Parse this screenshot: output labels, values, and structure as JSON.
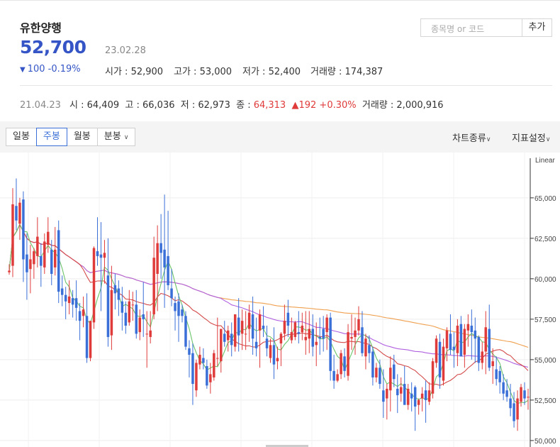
{
  "stock": {
    "name": "유한양행",
    "price": "52,700",
    "date": "23.02.28",
    "change": "100 -0.19%",
    "open": "시가 : 52,900",
    "high": "고가 : 53,000",
    "low": "저가 : 52,400",
    "volume": "거래량 : 174,387"
  },
  "search": {
    "placeholder": "종목명 or 코드",
    "add_label": "추가"
  },
  "history": {
    "date": "21.04.23",
    "open": "시 : 64,409",
    "high": "고 : 66,036",
    "low": "저 : 62,973",
    "close_label": "종 : ",
    "close_value": "64,313",
    "change": "▲192 +0.30%",
    "volume": "거래량 : 2,000,916"
  },
  "toolbar": {
    "tabs": [
      "일봉",
      "주봉",
      "월봉",
      "분봉"
    ],
    "active_tab": "주봉",
    "chart_type": "차트종류",
    "indicators": "지표설정"
  },
  "colors": {
    "up": "#e03b3b",
    "down": "#3a6fd8",
    "accent": "#3555c6",
    "ma5": "#6cc46a",
    "ma20": "#d44a4a",
    "ma60": "#b061e0",
    "ma120": "#f0a04e"
  },
  "chart_data": {
    "type": "candlestick",
    "scale": "Linear",
    "ylim": [
      49600,
      67800
    ],
    "yticks": [
      50000,
      52500,
      55000,
      57500,
      60000,
      62500,
      65000
    ],
    "ytick_labels": [
      "50,000",
      "52,500",
      "55,000",
      "57,500",
      "60,000",
      "62,500",
      "65,000"
    ],
    "candles": [
      [
        60400,
        60900,
        60250,
        60500
      ],
      [
        60800,
        65600,
        60100,
        64600
      ],
      [
        64500,
        66200,
        63000,
        63600
      ],
      [
        63400,
        65000,
        62400,
        64700
      ],
      [
        64900,
        65400,
        59800,
        61200
      ],
      [
        61500,
        62800,
        58700,
        60400
      ],
      [
        60600,
        62100,
        59100,
        61200
      ],
      [
        60900,
        61900,
        60000,
        61700
      ],
      [
        61400,
        63800,
        60700,
        62600
      ],
      [
        61400,
        62200,
        59500,
        60800
      ],
      [
        60700,
        62800,
        60300,
        62300
      ],
      [
        62100,
        63800,
        61600,
        62900
      ],
      [
        61800,
        62400,
        59600,
        60300
      ],
      [
        60700,
        63200,
        60200,
        61800
      ],
      [
        63000,
        63600,
        58500,
        59200
      ],
      [
        59400,
        60200,
        58300,
        59000
      ],
      [
        59000,
        59500,
        57500,
        58600
      ],
      [
        58500,
        59900,
        57800,
        58900
      ],
      [
        58800,
        59300,
        57600,
        58400
      ],
      [
        58800,
        59900,
        57400,
        58200
      ],
      [
        58000,
        58500,
        56200,
        57400
      ],
      [
        57700,
        58900,
        57000,
        58100
      ],
      [
        57700,
        59100,
        54800,
        55100
      ],
      [
        55100,
        56700,
        54900,
        57400
      ],
      [
        57300,
        62000,
        56900,
        61900
      ],
      [
        61700,
        63800,
        60800,
        61400
      ],
      [
        61500,
        63500,
        58000,
        61300
      ],
      [
        61300,
        62400,
        59700,
        61600
      ],
      [
        60200,
        62500,
        55800,
        56400
      ],
      [
        56500,
        60800,
        55600,
        59300
      ],
      [
        59600,
        60300,
        58100,
        59100
      ],
      [
        59400,
        59900,
        57700,
        58700
      ],
      [
        58600,
        59500,
        56800,
        57900
      ],
      [
        57900,
        58600,
        56600,
        57100
      ],
      [
        57300,
        59300,
        57100,
        58600
      ],
      [
        58400,
        59200,
        57400,
        58400
      ],
      [
        58400,
        59300,
        56300,
        56600
      ],
      [
        56700,
        58100,
        56200,
        57600
      ],
      [
        57800,
        59800,
        56400,
        57500
      ],
      [
        56600,
        58000,
        54500,
        56600
      ],
      [
        56400,
        58000,
        56000,
        56800
      ],
      [
        57800,
        62600,
        57500,
        61300
      ],
      [
        60300,
        63300,
        58000,
        62200
      ],
      [
        62200,
        64000,
        60000,
        61600
      ],
      [
        61800,
        65200,
        58200,
        60700
      ],
      [
        61400,
        64200,
        59300,
        59600
      ],
      [
        59400,
        60600,
        58300,
        58800
      ],
      [
        58500,
        58900,
        56800,
        58000
      ],
      [
        58600,
        59100,
        56100,
        57700
      ],
      [
        58100,
        58400,
        57300,
        57700
      ],
      [
        57700,
        58000,
        55600,
        55800
      ],
      [
        55700,
        56200,
        53900,
        55300
      ],
      [
        55400,
        56000,
        52200,
        53500
      ],
      [
        53100,
        55000,
        52700,
        54800
      ],
      [
        54700,
        55800,
        54400,
        55300
      ],
      [
        55100,
        55700,
        54400,
        54800
      ],
      [
        54600,
        55000,
        53200,
        53400
      ],
      [
        53600,
        54800,
        52900,
        54100
      ],
      [
        53900,
        55600,
        53700,
        55400
      ],
      [
        55100,
        57600,
        54600,
        55100
      ],
      [
        54900,
        56500,
        54200,
        56900
      ],
      [
        56600,
        57400,
        55800,
        56100
      ],
      [
        56200,
        57100,
        55500,
        56800
      ],
      [
        56600,
        57300,
        55200,
        55900
      ],
      [
        55800,
        57800,
        55500,
        57800
      ],
      [
        57600,
        58800,
        55500,
        56500
      ],
      [
        56600,
        58100,
        55600,
        57400
      ],
      [
        56600,
        58000,
        55600,
        56600
      ],
      [
        56900,
        58400,
        56100,
        57900
      ],
      [
        57800,
        58900,
        55300,
        56300
      ],
      [
        56100,
        57600,
        55200,
        55700
      ],
      [
        56800,
        58100,
        54500,
        57800
      ],
      [
        57100,
        58300,
        56400,
        56900
      ],
      [
        56300,
        57100,
        55200,
        55700
      ],
      [
        55100,
        56300,
        54800,
        55900
      ],
      [
        55900,
        57000,
        53800,
        54700
      ],
      [
        54900,
        55800,
        54400,
        55100
      ],
      [
        56000,
        56700,
        54600,
        56600
      ],
      [
        56600,
        58400,
        56200,
        57400
      ],
      [
        57900,
        58700,
        56400,
        57100
      ],
      [
        56200,
        57600,
        56000,
        56700
      ],
      [
        56400,
        57400,
        56200,
        57300
      ],
      [
        56700,
        58000,
        56000,
        56600
      ],
      [
        56700,
        57900,
        56200,
        57100
      ],
      [
        56200,
        58000,
        55300,
        56400
      ],
      [
        56300,
        58000,
        55400,
        56900
      ],
      [
        56900,
        57800,
        55200,
        55800
      ],
      [
        55900,
        57300,
        54600,
        56100
      ],
      [
        56400,
        57600,
        55300,
        56300
      ],
      [
        56900,
        57700,
        55500,
        56300
      ],
      [
        56700,
        57800,
        55600,
        57600
      ],
      [
        57600,
        57900,
        53700,
        54300
      ],
      [
        54300,
        55300,
        53200,
        53700
      ],
      [
        53700,
        54400,
        53600,
        54100
      ],
      [
        54100,
        55600,
        53800,
        55400
      ],
      [
        55200,
        55700,
        53900,
        54300
      ],
      [
        54000,
        57200,
        53700,
        56700
      ],
      [
        56300,
        57800,
        55600,
        56400
      ],
      [
        56400,
        57600,
        55300,
        56800
      ],
      [
        56800,
        58300,
        56500,
        57500
      ],
      [
        57000,
        58000,
        55200,
        55400
      ],
      [
        55200,
        56600,
        54400,
        56300
      ],
      [
        55900,
        56500,
        54800,
        55400
      ],
      [
        55500,
        55800,
        53400,
        53900
      ],
      [
        53900,
        54800,
        53600,
        54500
      ],
      [
        54500,
        55000,
        53200,
        53500
      ],
      [
        53100,
        54400,
        51400,
        52400
      ],
      [
        52600,
        53500,
        51300,
        53200
      ],
      [
        53100,
        55200,
        51800,
        54500
      ],
      [
        54700,
        55300,
        53300,
        53800
      ],
      [
        53200,
        54100,
        51700,
        52800
      ],
      [
        52900,
        53900,
        52400,
        53300
      ],
      [
        53500,
        54600,
        52600,
        52200
      ],
      [
        52200,
        53500,
        51900,
        53200
      ],
      [
        52900,
        53600,
        51800,
        52600
      ],
      [
        53300,
        53400,
        50600,
        52100
      ],
      [
        52200,
        52600,
        51600,
        52500
      ],
      [
        52600,
        53300,
        51800,
        52900
      ],
      [
        53100,
        53700,
        51100,
        52500
      ],
      [
        52400,
        53600,
        52200,
        53100
      ],
      [
        52900,
        55100,
        52600,
        54900
      ],
      [
        54800,
        56500,
        54500,
        56300
      ],
      [
        56100,
        56600,
        53200,
        53900
      ],
      [
        53700,
        56300,
        53400,
        55800
      ],
      [
        55700,
        57000,
        54900,
        56800
      ],
      [
        56600,
        57800,
        55300,
        55600
      ],
      [
        55800,
        56700,
        54500,
        55600
      ],
      [
        55400,
        57500,
        54600,
        57100
      ],
      [
        57200,
        57700,
        55400,
        55200
      ],
      [
        55300,
        57200,
        54500,
        56900
      ],
      [
        56800,
        57800,
        55800,
        57200
      ],
      [
        57100,
        58100,
        55000,
        56700
      ],
      [
        56800,
        57600,
        54800,
        56300
      ],
      [
        56400,
        56500,
        54300,
        54800
      ],
      [
        54800,
        56100,
        54400,
        55500
      ],
      [
        55500,
        58000,
        54100,
        57000
      ],
      [
        56900,
        58400,
        54300,
        54500
      ],
      [
        54600,
        55700,
        53500,
        54900
      ],
      [
        54400,
        55200,
        53400,
        53800
      ],
      [
        54300,
        54600,
        52900,
        53600
      ],
      [
        53600,
        54100,
        52500,
        52900
      ],
      [
        53100,
        53800,
        52400,
        52700
      ],
      [
        52600,
        53500,
        51500,
        52000
      ],
      [
        52300,
        53000,
        50800,
        51200
      ],
      [
        51300,
        53100,
        50600,
        52600
      ],
      [
        52400,
        53500,
        52100,
        53300
      ],
      [
        53100,
        53600,
        52200,
        52600
      ],
      [
        52700,
        53200,
        51900,
        52700
      ]
    ]
  }
}
